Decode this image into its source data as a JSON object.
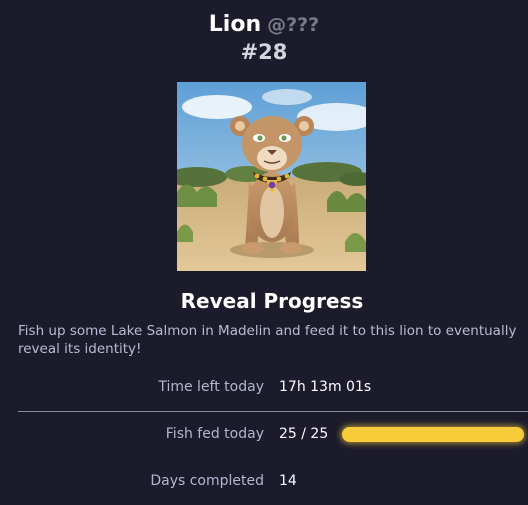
{
  "header": {
    "name": "Lion",
    "handle": "@???",
    "token_id": "#28"
  },
  "artwork": {
    "subject": "cartoon lioness sitting in savanna wearing a jeweled collar"
  },
  "reveal": {
    "title": "Reveal Progress",
    "description": "Fish up some Lake Salmon in Madelin and feed it to this lion to eventually reveal its identity!"
  },
  "stats": {
    "time_left_label": "Time left today",
    "time_left_value": "17h 13m 01s",
    "fish_fed_label": "Fish fed today",
    "fish_fed_value": "25 / 25",
    "fish_fed_progress": 1.0,
    "days_completed_label": "Days completed",
    "days_completed_value": "14"
  },
  "colors": {
    "background": "#1b1b2c",
    "progress": "#f6cc3a",
    "muted_text": "#b0b8cf"
  }
}
